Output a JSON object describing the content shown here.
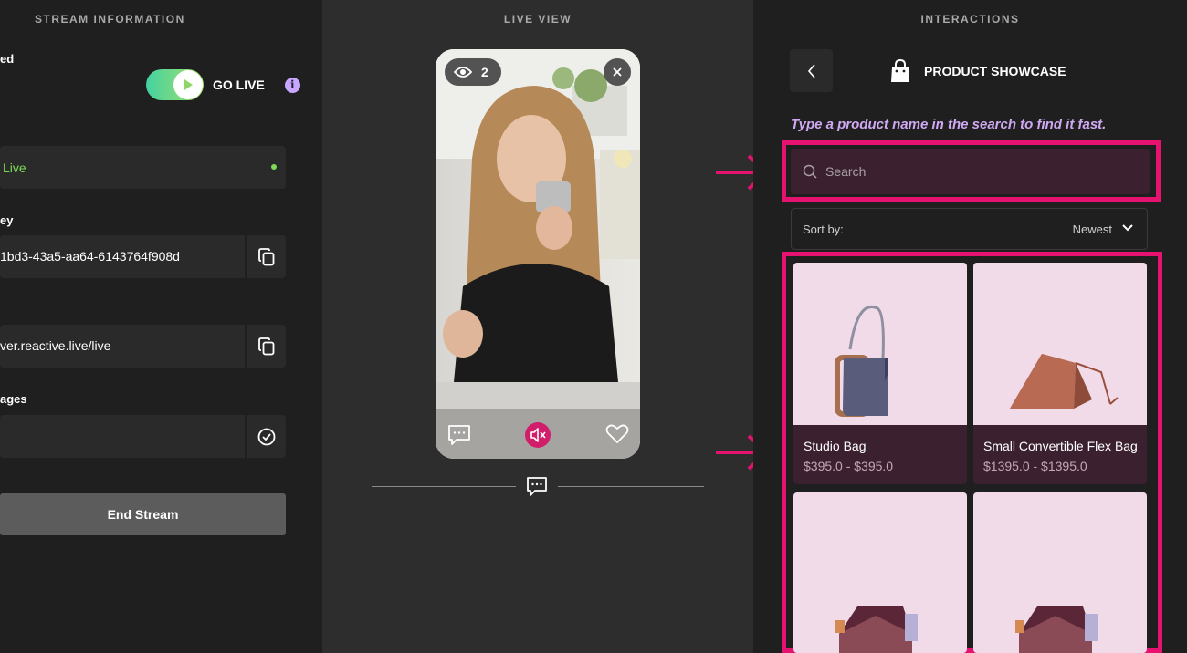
{
  "left_panel": {
    "heading": "STREAM INFORMATION",
    "labels": {
      "status_suffix": "ed",
      "key_suffix": "ey",
      "messages_suffix": "ages"
    },
    "go_live_label": "GO LIVE",
    "info_icon": "info-icon",
    "status_value": "Live",
    "stream_key_value": "1bd3-43a5-aa64-6143764f908d",
    "server_url_value": "ver.reactive.live/live",
    "messages_value": "",
    "end_stream_label": "End Stream",
    "colors": {
      "live_green": "#7ed957",
      "toggle_start": "#43d2a0",
      "toggle_end": "#a7e06a",
      "info": "#c9a6ff"
    }
  },
  "middle_panel": {
    "heading": "LIVE VIEW",
    "viewer_count": "2"
  },
  "right_panel": {
    "heading": "INTERACTIONS",
    "title": "PRODUCT SHOWCASE",
    "hint": "Type a product name in the search to find it fast.",
    "search_placeholder": "Search",
    "sort_label": "Sort by:",
    "sort_value": "Newest",
    "products": [
      {
        "name": "Studio Bag",
        "price": "$395.0 - $395.0"
      },
      {
        "name": "Small Convertible Flex Bag",
        "price": "$1395.0 - $1395.0"
      },
      {
        "name": "",
        "price": ""
      },
      {
        "name": "",
        "price": ""
      }
    ],
    "colors": {
      "highlight": "#e5136f",
      "card_bg": "#3b2130",
      "card_image_bg": "#f1dbe8",
      "hint": "#cfa9f2"
    }
  }
}
